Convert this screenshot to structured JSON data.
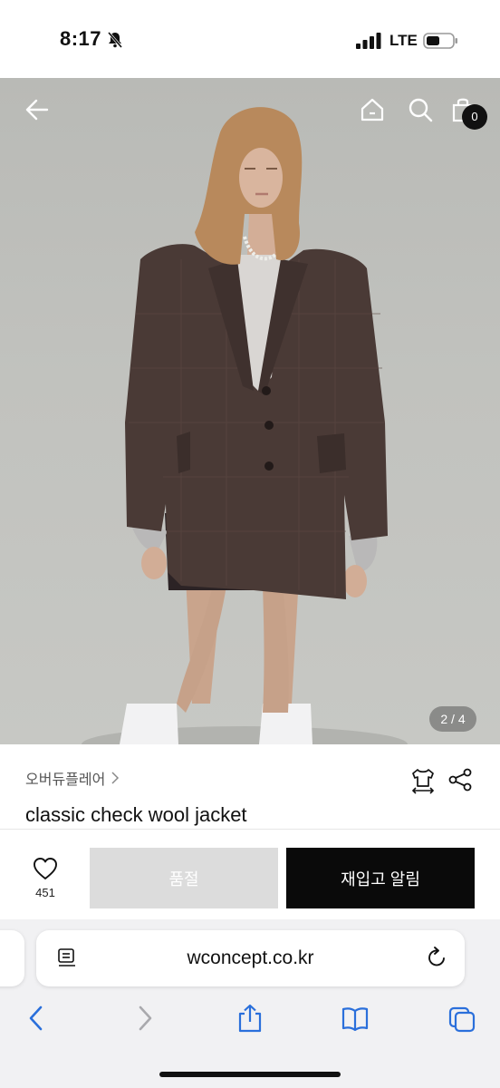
{
  "status_bar": {
    "time": "8:17",
    "network": "LTE"
  },
  "header": {
    "cart_count": "0"
  },
  "gallery": {
    "pager": "2 / 4"
  },
  "product": {
    "brand": "오버듀플레어",
    "name": "classic check wool jacket"
  },
  "actions": {
    "wish_count": "451",
    "soldout_label": "품절",
    "restock_label": "재입고 알림"
  },
  "browser": {
    "url": "wconcept.co.kr"
  },
  "colors": {
    "restock_button": "#0a0a0a",
    "soldout_button": "#dcdcdc",
    "safari_bar": "#f1f1f3"
  },
  "icons": [
    "back-arrow-icon",
    "home-icon",
    "search-icon",
    "shopping-bag-icon",
    "size-fit-icon",
    "share-icon",
    "heart-icon",
    "reader-icon",
    "reload-icon",
    "safari-back-icon",
    "safari-forward-icon",
    "share-sheet-icon",
    "bookmarks-icon",
    "tabs-icon"
  ]
}
